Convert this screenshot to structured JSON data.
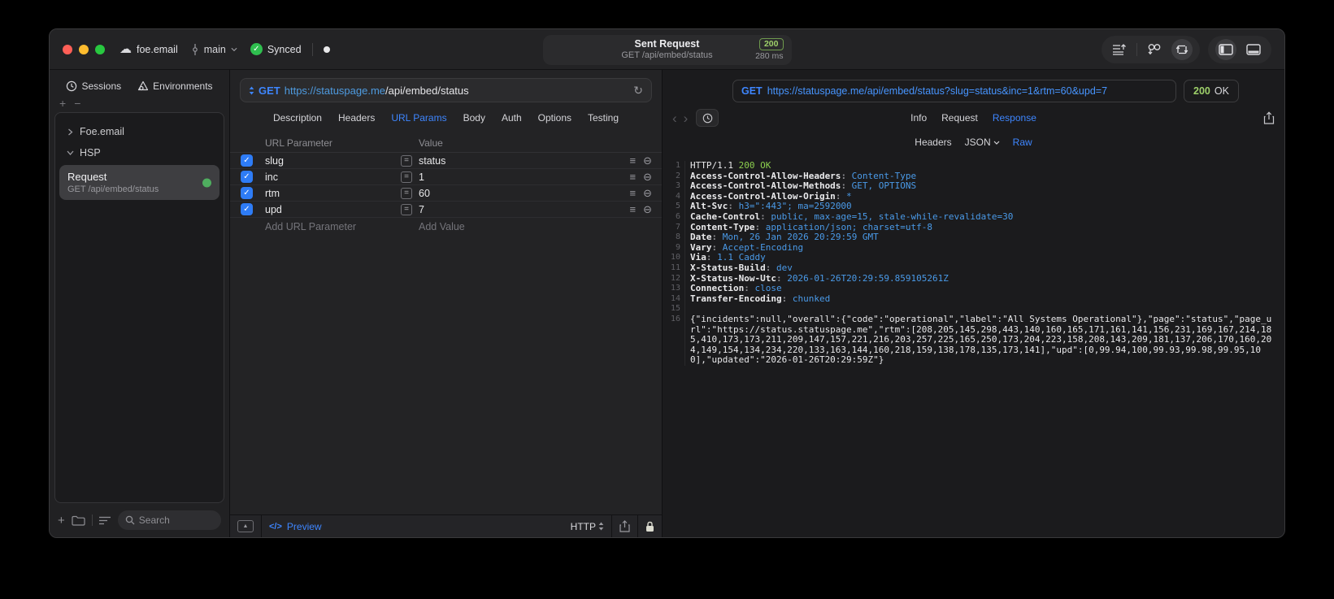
{
  "titlebar": {
    "project": "foe.email",
    "branch": "main",
    "sync_status": "Synced",
    "request_title": "Sent Request",
    "request_subtitle": "GET /api/embed/status",
    "status_code": "200",
    "duration": "280 ms"
  },
  "sidebar": {
    "tabs": {
      "sessions": "Sessions",
      "environments": "Environments"
    },
    "tree": [
      {
        "label": "Foe.email",
        "state": "collapsed"
      },
      {
        "label": "HSP",
        "state": "expanded"
      }
    ],
    "request_item": {
      "title": "Request",
      "subtitle": "GET /api/embed/status"
    },
    "search_placeholder": "Search"
  },
  "request_pane": {
    "method": "GET",
    "url_host": "https://statuspage.me",
    "url_path": "/api/embed/status",
    "tabs": [
      "Description",
      "Headers",
      "URL Params",
      "Body",
      "Auth",
      "Options",
      "Testing"
    ],
    "active_tab": "URL Params",
    "table": {
      "columns": [
        "URL Parameter",
        "Value"
      ],
      "rows": [
        {
          "name": "slug",
          "value": "status",
          "enabled": true
        },
        {
          "name": "inc",
          "value": "1",
          "enabled": true
        },
        {
          "name": "rtm",
          "value": "60",
          "enabled": true
        },
        {
          "name": "upd",
          "value": "7",
          "enabled": true
        }
      ],
      "add_name_placeholder": "Add URL Parameter",
      "add_value_placeholder": "Add Value"
    },
    "footer": {
      "preview_label": "Preview",
      "code_glyph": "</>",
      "http_label": "HTTP"
    }
  },
  "response_pane": {
    "method": "GET",
    "url": "https://statuspage.me/api/embed/status?slug=status&inc=1&rtm=60&upd=7",
    "status_code": "200",
    "status_text": "OK",
    "tabs": [
      "Info",
      "Request",
      "Response"
    ],
    "active_tab": "Response",
    "subtabs": [
      "Headers",
      "JSON",
      "Raw"
    ],
    "active_subtab": "Raw",
    "raw_lines": [
      {
        "n": 1,
        "t": "status",
        "k": "HTTP/1.1",
        "v": "200 OK"
      },
      {
        "n": 2,
        "t": "h",
        "k": "Access-Control-Allow-Headers",
        "v": "Content-Type"
      },
      {
        "n": 3,
        "t": "h",
        "k": "Access-Control-Allow-Methods",
        "v": "GET, OPTIONS"
      },
      {
        "n": 4,
        "t": "h",
        "k": "Access-Control-Allow-Origin",
        "v": "*"
      },
      {
        "n": 5,
        "t": "h",
        "k": "Alt-Svc",
        "v": "h3=\":443\"; ma=2592000"
      },
      {
        "n": 6,
        "t": "h",
        "k": "Cache-Control",
        "v": "public, max-age=15, stale-while-revalidate=30"
      },
      {
        "n": 7,
        "t": "h",
        "k": "Content-Type",
        "v": "application/json; charset=utf-8"
      },
      {
        "n": 8,
        "t": "h",
        "k": "Date",
        "v": "Mon, 26 Jan 2026 20:29:59 GMT"
      },
      {
        "n": 9,
        "t": "h",
        "k": "Vary",
        "v": "Accept-Encoding"
      },
      {
        "n": 10,
        "t": "h",
        "k": "Via",
        "v": "1.1 Caddy"
      },
      {
        "n": 11,
        "t": "h",
        "k": "X-Status-Build",
        "v": "dev"
      },
      {
        "n": 12,
        "t": "h",
        "k": "X-Status-Now-Utc",
        "v": "2026-01-26T20:29:59.859105261Z"
      },
      {
        "n": 13,
        "t": "h",
        "k": "Connection",
        "v": "close"
      },
      {
        "n": 14,
        "t": "h",
        "k": "Transfer-Encoding",
        "v": "chunked"
      },
      {
        "n": 15,
        "t": "blank"
      },
      {
        "n": 16,
        "t": "body",
        "v": "{\"incidents\":null,\"overall\":{\"code\":\"operational\",\"label\":\"All Systems Operational\"},\"page\":\"status\",\"page_url\":\"https://status.statuspage.me\",\"rtm\":[208,205,145,298,443,140,160,165,171,161,141,156,231,169,167,214,185,410,173,173,211,209,147,157,221,216,203,257,225,165,250,173,204,223,158,208,143,209,181,137,206,170,160,204,149,154,134,234,220,133,163,144,160,218,159,138,178,135,173,141],\"upd\":[0,99.94,100,99.93,99.98,99.95,100],\"updated\":\"2026-01-26T20:29:59Z\"}"
      }
    ]
  },
  "icons": {
    "cloud": "☁",
    "check": "✓",
    "plus": "+",
    "minus": "−",
    "reload": "↻",
    "equals": "=",
    "row_options": "≡",
    "row_remove": "⊖",
    "expand_up": "▲",
    "back": "‹",
    "forward": "›",
    "dot": "●"
  },
  "colors": {
    "accent_blue": "#3e86ff",
    "value_blue": "#4a9ae8",
    "status_green": "#8ccf4e",
    "badge_green": "#9ed06a",
    "checkbox_blue": "#2e7cf6",
    "synced_green": "#2fbf4f"
  }
}
